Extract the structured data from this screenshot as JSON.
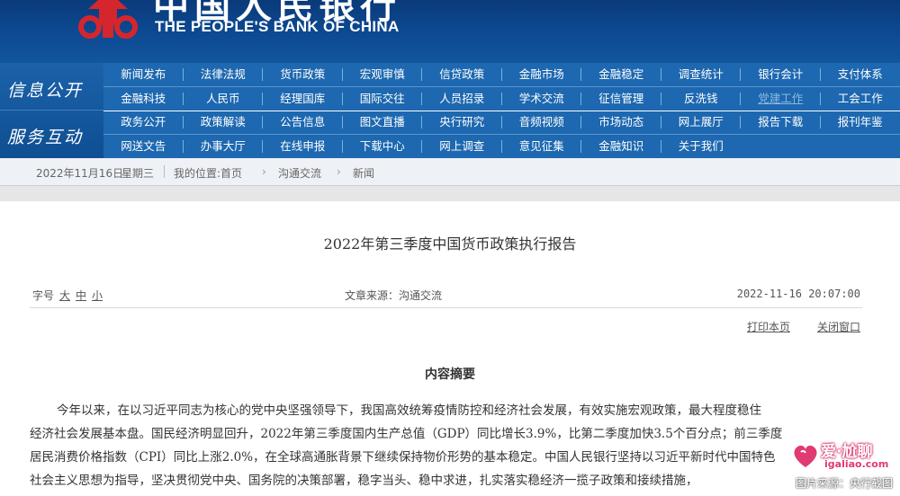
{
  "header": {
    "cn_title": "中国人民银行",
    "en_title": "THE PEOPLE'S BANK OF CHINA"
  },
  "nav": {
    "category_1": "信息公开",
    "category_2": "服务互动",
    "rows": [
      [
        "新闻发布",
        "法律法规",
        "货币政策",
        "宏观审慎",
        "信贷政策",
        "金融市场",
        "金融稳定",
        "调查统计",
        "银行会计",
        "支付体系"
      ],
      [
        "金融科技",
        "人民币",
        "经理国库",
        "国际交往",
        "人员招录",
        "学术交流",
        "征信管理",
        "反洗钱",
        "党建工作",
        "工会工作"
      ],
      [
        "政务公开",
        "政策解读",
        "公告信息",
        "图文直播",
        "央行研究",
        "音频视频",
        "市场动态",
        "网上展厅",
        "报告下载",
        "报刊年鉴"
      ],
      [
        "网送文告",
        "办事大厅",
        "在线申报",
        "下载中心",
        "网上调查",
        "意见征集",
        "金融知识",
        "关于我们"
      ]
    ]
  },
  "datebar": {
    "date": "2022年11月16日",
    "weekday": "星期三",
    "location_label": "我的位置:首页",
    "crumb_2": "沟通交流",
    "crumb_3": "新闻",
    "arrow": "›"
  },
  "article": {
    "title": "2022年第三季度中国货币政策执行报告",
    "font_label": "字号",
    "font_large": "大",
    "font_medium": "中",
    "font_small": "小",
    "source": "文章来源：沟通交流",
    "datetime": "2022-11-16 20:07:00",
    "print": "打印本页",
    "close": "关闭窗口",
    "section_title": "内容摘要",
    "lines": [
      "今年以来，在以习近平同志为核心的党中央坚强领导下，我国高效统筹疫情防控和经济社会发展，有效实施宏观政策，最大程度稳住",
      "经济社会发展基本盘。国民经济明显回升，2022年第三季度国内生产总值（GDP）同比增长3.9%，比第二季度加快3.5个百分点；前三季度",
      "居民消费价格指数（CPI）同比上涨2.0%，在全球高通胀背景下继续保持物价形势的基本稳定。中国人民银行坚持以习近平新时代中国特色",
      "社会主义思想为指导，坚决贯彻党中央、国务院的决策部署，稳字当头、稳中求进，扎实落实稳经济一揽子政策和接续措施，"
    ]
  },
  "watermark": {
    "brand": "爱·尬聊",
    "domain": "igaliao.com",
    "credit": "图片来源：央行截图"
  },
  "colors": {
    "header_blue": "#0d4a93",
    "nav_blue": "#1d68b0",
    "emblem_red": "#d6262d"
  }
}
